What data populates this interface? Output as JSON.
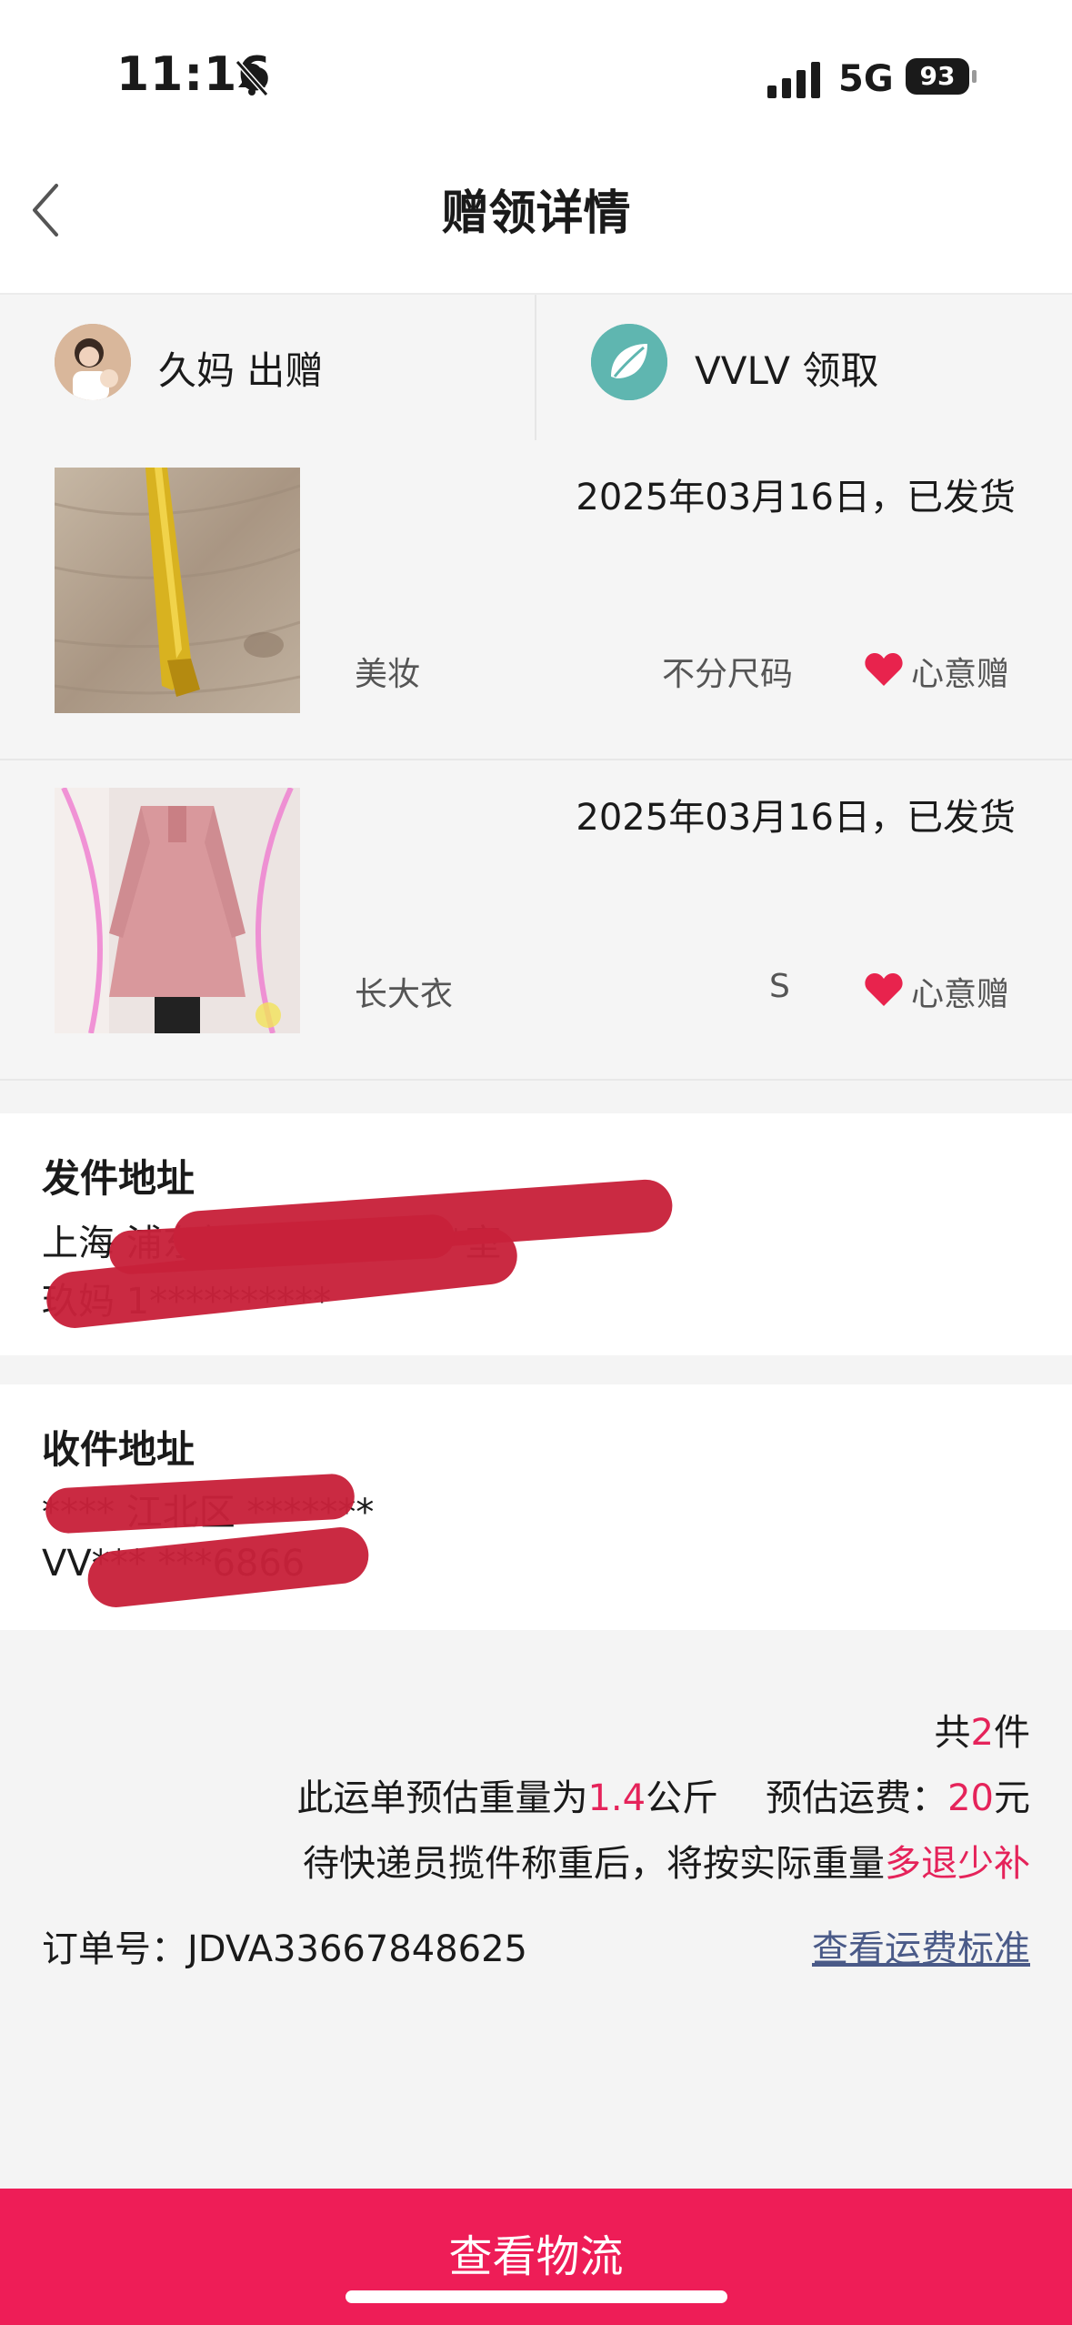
{
  "status": {
    "time": "11:16",
    "network": "5G",
    "battery": "93"
  },
  "nav": {
    "title": "赠领详情"
  },
  "giver": {
    "name": "久妈 出赠"
  },
  "receiver": {
    "name": "VVLV 领取"
  },
  "items": [
    {
      "date_status": "2025年03月16日，已发货",
      "category": "美妆",
      "size": "不分尺码",
      "tag": "心意赠"
    },
    {
      "date_status": "2025年03月16日，已发货",
      "category": "长大衣",
      "size": "S",
      "tag": "心意赠"
    }
  ],
  "sender_address": {
    "title": "发件地址",
    "line1": "上海 浦东新区 **********室",
    "line2": "玖妈 1**********"
  },
  "receiver_address": {
    "title": "收件地址",
    "line1": "**** 江北区 *******",
    "line2": "VV*** ***6866"
  },
  "summary": {
    "total_prefix": "共",
    "total_count": "2",
    "total_suffix": "件",
    "weight_prefix": "此运单预估重量为",
    "weight_value": "1.4",
    "weight_unit": "公斤",
    "fee_prefix": "预估运费：",
    "fee_value": "20",
    "fee_unit": "元",
    "note_prefix": "待快递员揽件称重后，将按实际重量",
    "note_highlight": "多退少补",
    "order_label": "订单号：JDVA33667848625",
    "fee_link": "查看运费标准"
  },
  "bottom_button": "查看物流",
  "colors": {
    "accent": "#ee1d57",
    "highlight": "#e5235a",
    "link": "#4a5a88",
    "redaction": "#c8213a"
  }
}
